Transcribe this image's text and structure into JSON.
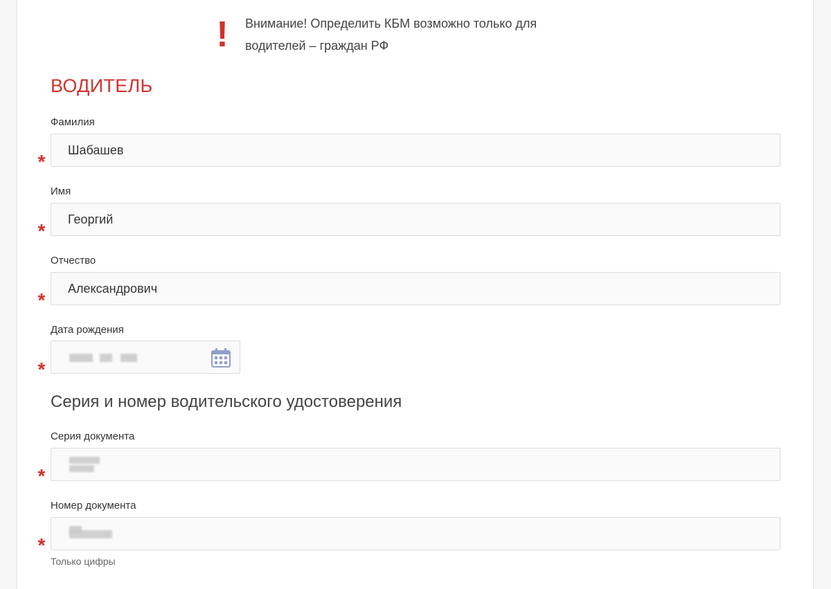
{
  "notice": {
    "icon": "exclamation-icon",
    "text": "Внимание! Определить КБМ возможно только для водителей – граждан РФ"
  },
  "section": {
    "title": "ВОДИТЕЛЬ"
  },
  "fields": {
    "last_name": {
      "label": "Фамилия",
      "value": "Шабашев"
    },
    "first_name": {
      "label": "Имя",
      "value": "Георгий"
    },
    "patronymic": {
      "label": "Отчество",
      "value": "Александрович"
    },
    "birth_date": {
      "label": "Дата рождения",
      "icon": "calendar-icon"
    }
  },
  "license": {
    "title": "Серия и номер водительского удостоверения",
    "series": {
      "label": "Серия документа"
    },
    "number": {
      "label": "Номер документа",
      "hint": "Только цифры"
    }
  },
  "required_mark": "*",
  "colors": {
    "accent": "#d2312d",
    "icon": "#8fa0c8"
  }
}
